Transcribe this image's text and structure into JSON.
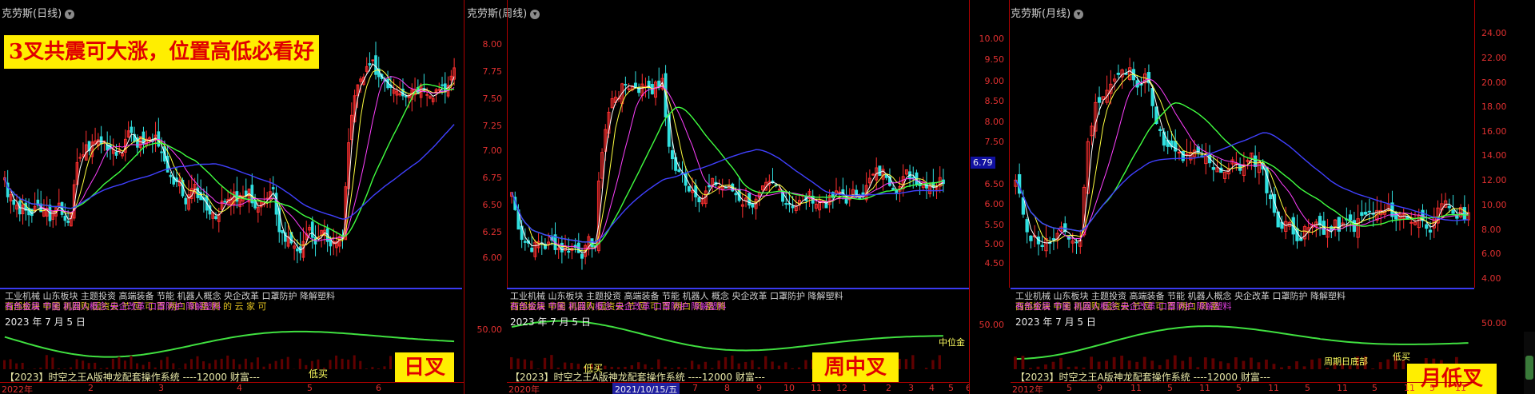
{
  "panels": [
    {
      "title": "克劳斯(日线)",
      "headline": "3叉共震可大涨，位置高低必看好",
      "label": "日叉",
      "date": "2023 年 7 月 5 日",
      "info_lines": [
        "工业机械 山东板块 主题投资 高端装备 节能 机器人概念 央企改革 口罩防护 降解塑料",
        "西部板块 中国 再回购 国资云 节 回 可 百 两口 凤 凰 腾 的 云 家 可",
        "有色金属 节能 机器人概念 央企改革 口罩防护 降解塑料"
      ],
      "sys": "【2023】时空之王A版神龙配套操作系统 ----12000  财富---",
      "marker": "低买",
      "marker2": "叉",
      "xlabels": [
        "2022年",
        "2",
        "3",
        "4",
        "5",
        "6"
      ],
      "yticks": [],
      "sub_ticks": []
    },
    {
      "title": "克劳斯(周线)",
      "label": "周中叉",
      "date": "2023 年 7 月 5 日",
      "info_lines": [
        "工业机械 山东板块 主题投资 高端装备 节能 机器人 概念 央企改革 口罩防护 降解塑料",
        "西部板块 中国 再回购 国资云 节 回 可 百 两口 凤 凰 腾",
        "有色金属 节能 机器人概念 央企改革 口罩防护 降解塑料"
      ],
      "sys": "【2023】时空之王A版神龙配套操作系统 ----12000  财富---",
      "marker": "低买",
      "marker2": "中位金",
      "xlabels": [
        "2020年",
        "2021/10/15/五",
        "7",
        "8",
        "9",
        "10",
        "11",
        "12",
        "1",
        "2",
        "3",
        "4",
        "5",
        "6",
        "7"
      ],
      "yticks": [
        "8.00",
        "7.75",
        "7.50",
        "7.25",
        "7.00",
        "6.75",
        "6.50",
        "6.25",
        "6.00"
      ],
      "sub_ticks": [
        "50.00"
      ],
      "price_tag": "6.79"
    },
    {
      "title": "克劳斯(月线)",
      "label": "月低叉",
      "date": "2023 年 7 月 5 日",
      "info_lines": [
        "工业机械 山东板块 主题投资 高端装备 节能 机器人概念 央企改革 口罩防护 降解塑料",
        "西部板块 中国 再回购 国资云 节 回 可 百 两口 凤 凰",
        "有色金属 节能 机器人概念 央企改革 口罩防护 降解塑料"
      ],
      "sys": "【2023】时空之王A版神龙配套操作系统 ----12000  财富---",
      "marker": "低买",
      "marker2": "周期日底部",
      "xlabels": [
        "2012年",
        "5",
        "9",
        "11",
        "5",
        "11",
        "5",
        "11",
        "5",
        "11",
        "5",
        "11",
        "5",
        "11",
        "5"
      ],
      "yticks": [
        "24.00",
        "22.00",
        "20.00",
        "18.00",
        "16.00",
        "14.00",
        "12.00",
        "10.00",
        "8.00",
        "6.00",
        "4.00"
      ],
      "sub_ticks": [
        "50.00"
      ],
      "left_ticks": [
        "10.00",
        "9.50",
        "9.00",
        "8.50",
        "8.00",
        "7.50",
        "7.00",
        "6.50",
        "6.00",
        "5.50",
        "5.00",
        "4.50"
      ],
      "left_sub": "50.00"
    }
  ],
  "colors": {
    "up": "#ff3030",
    "down": "#30e0e0",
    "ma1": "#ffffff",
    "ma2": "#ffff40",
    "ma3": "#ff40ff",
    "ma4": "#40ff40",
    "ma5": "#4040ff",
    "grid": "#b00000"
  }
}
